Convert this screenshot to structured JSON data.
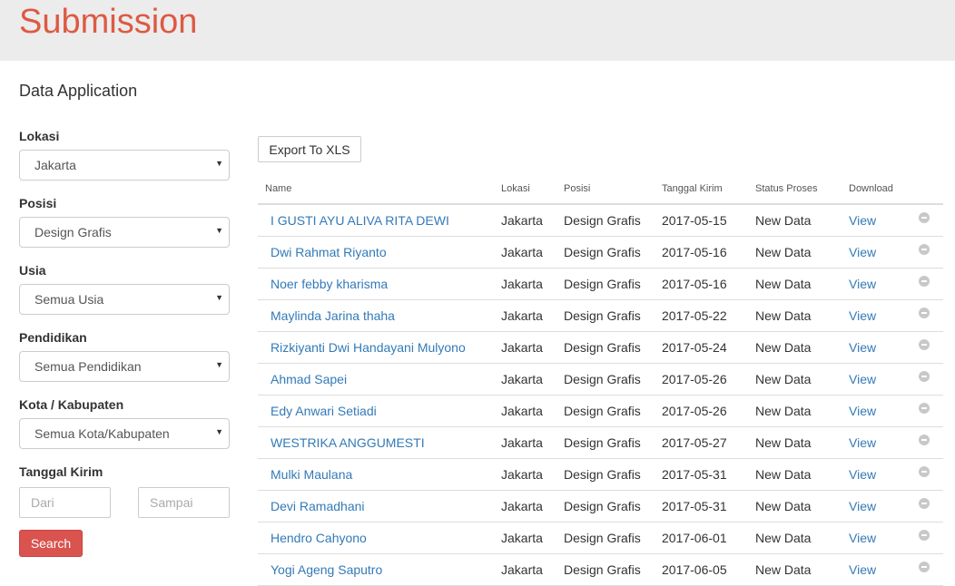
{
  "header": {
    "title": "Submission"
  },
  "section_title": "Data Application",
  "filters": {
    "lokasi": {
      "label": "Lokasi",
      "value": "Jakarta"
    },
    "posisi": {
      "label": "Posisi",
      "value": "Design Grafis"
    },
    "usia": {
      "label": "Usia",
      "value": "Semua Usia"
    },
    "pendidikan": {
      "label": "Pendidikan",
      "value": "Semua Pendidikan"
    },
    "kota": {
      "label": "Kota / Kabupaten",
      "value": "Semua Kota/Kabupaten"
    },
    "tanggal": {
      "label": "Tanggal Kirim",
      "from_placeholder": "Dari",
      "to_placeholder": "Sampai"
    },
    "search_label": "Search"
  },
  "export_label": "Export To XLS",
  "table": {
    "columns": [
      "Name",
      "Lokasi",
      "Posisi",
      "Tanggal Kirim",
      "Status Proses",
      "Download"
    ],
    "rows": [
      {
        "name": "I GUSTI AYU ALIVA RITA DEWI",
        "lokasi": "Jakarta",
        "posisi": "Design Grafis",
        "tanggal": "2017-05-15",
        "status": "New Data",
        "download": "View"
      },
      {
        "name": "Dwi Rahmat Riyanto",
        "lokasi": "Jakarta",
        "posisi": "Design Grafis",
        "tanggal": "2017-05-16",
        "status": "New Data",
        "download": "View"
      },
      {
        "name": "Noer febby kharisma",
        "lokasi": "Jakarta",
        "posisi": "Design Grafis",
        "tanggal": "2017-05-16",
        "status": "New Data",
        "download": "View"
      },
      {
        "name": "Maylinda Jarina thaha",
        "lokasi": "Jakarta",
        "posisi": "Design Grafis",
        "tanggal": "2017-05-22",
        "status": "New Data",
        "download": "View"
      },
      {
        "name": "Rizkiyanti Dwi Handayani Mulyono",
        "lokasi": "Jakarta",
        "posisi": "Design Grafis",
        "tanggal": "2017-05-24",
        "status": "New Data",
        "download": "View"
      },
      {
        "name": "Ahmad Sapei",
        "lokasi": "Jakarta",
        "posisi": "Design Grafis",
        "tanggal": "2017-05-26",
        "status": "New Data",
        "download": "View"
      },
      {
        "name": "Edy Anwari Setiadi",
        "lokasi": "Jakarta",
        "posisi": "Design Grafis",
        "tanggal": "2017-05-26",
        "status": "New Data",
        "download": "View"
      },
      {
        "name": "WESTRIKA ANGGUMESTI",
        "lokasi": "Jakarta",
        "posisi": "Design Grafis",
        "tanggal": "2017-05-27",
        "status": "New Data",
        "download": "View"
      },
      {
        "name": "Mulki Maulana",
        "lokasi": "Jakarta",
        "posisi": "Design Grafis",
        "tanggal": "2017-05-31",
        "status": "New Data",
        "download": "View"
      },
      {
        "name": "Devi Ramadhani",
        "lokasi": "Jakarta",
        "posisi": "Design Grafis",
        "tanggal": "2017-05-31",
        "status": "New Data",
        "download": "View"
      },
      {
        "name": "Hendro Cahyono",
        "lokasi": "Jakarta",
        "posisi": "Design Grafis",
        "tanggal": "2017-06-01",
        "status": "New Data",
        "download": "View"
      },
      {
        "name": "Yogi Ageng Saputro",
        "lokasi": "Jakarta",
        "posisi": "Design Grafis",
        "tanggal": "2017-06-05",
        "status": "New Data",
        "download": "View"
      }
    ]
  },
  "colors": {
    "accent": "#dd5a43",
    "link": "#337ab7",
    "search_button": "#d9534f"
  },
  "icons": {
    "select_caret": "caret-down-icon",
    "row_remove": "remove-circle-icon"
  }
}
